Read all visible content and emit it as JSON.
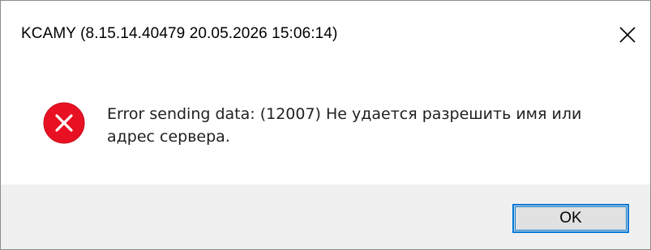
{
  "window": {
    "title": "KCAMY (8.15.14.40479 20.05.2026 15:06:14)"
  },
  "message": {
    "text": "Error sending data: (12007) Не удается разрешить имя или адрес сервера."
  },
  "icons": {
    "close": "close-icon",
    "status": "error-icon"
  },
  "buttons": {
    "ok_label": "OK"
  },
  "colors": {
    "error_icon_fill": "#e81123",
    "accent_focus": "#0078d7",
    "footer_bg": "#f0f0f0"
  }
}
